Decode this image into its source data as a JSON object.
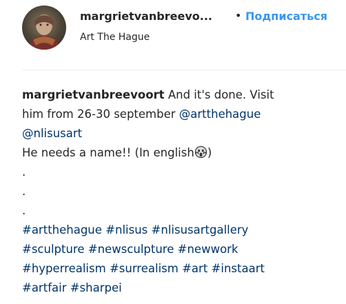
{
  "post": {
    "header": {
      "username": "margrietvanbreevo...",
      "separator": "•",
      "follow_label": "Подписаться",
      "location": "Art The Hague"
    },
    "caption": {
      "author": "margrietvanbreevoort",
      "text_1": "And it's done. Visit",
      "text_2": "him from 26-30 september",
      "mention_1": "@artthehague",
      "mention_2": "@nlisusart",
      "text_3": "He needs a name!! (In english",
      "emoji": "scream-emoji",
      "close_paren": ")",
      "dot": ".",
      "hashtags_line_1": [
        "#artthehague",
        "#nlisus",
        "#nlisusartgallery"
      ],
      "hashtags_line_2": [
        "#sculpture",
        "#newsculpture",
        "#newwork"
      ],
      "hashtags_line_3": [
        "#hyperrealism",
        "#surrealism",
        "#art",
        "#instaart"
      ],
      "hashtags_line_4": [
        "#artfair",
        "#sharpei"
      ]
    }
  },
  "colors": {
    "text": "#262626",
    "follow": "#3897f0",
    "link": "#003569",
    "divider": "#efefef"
  }
}
